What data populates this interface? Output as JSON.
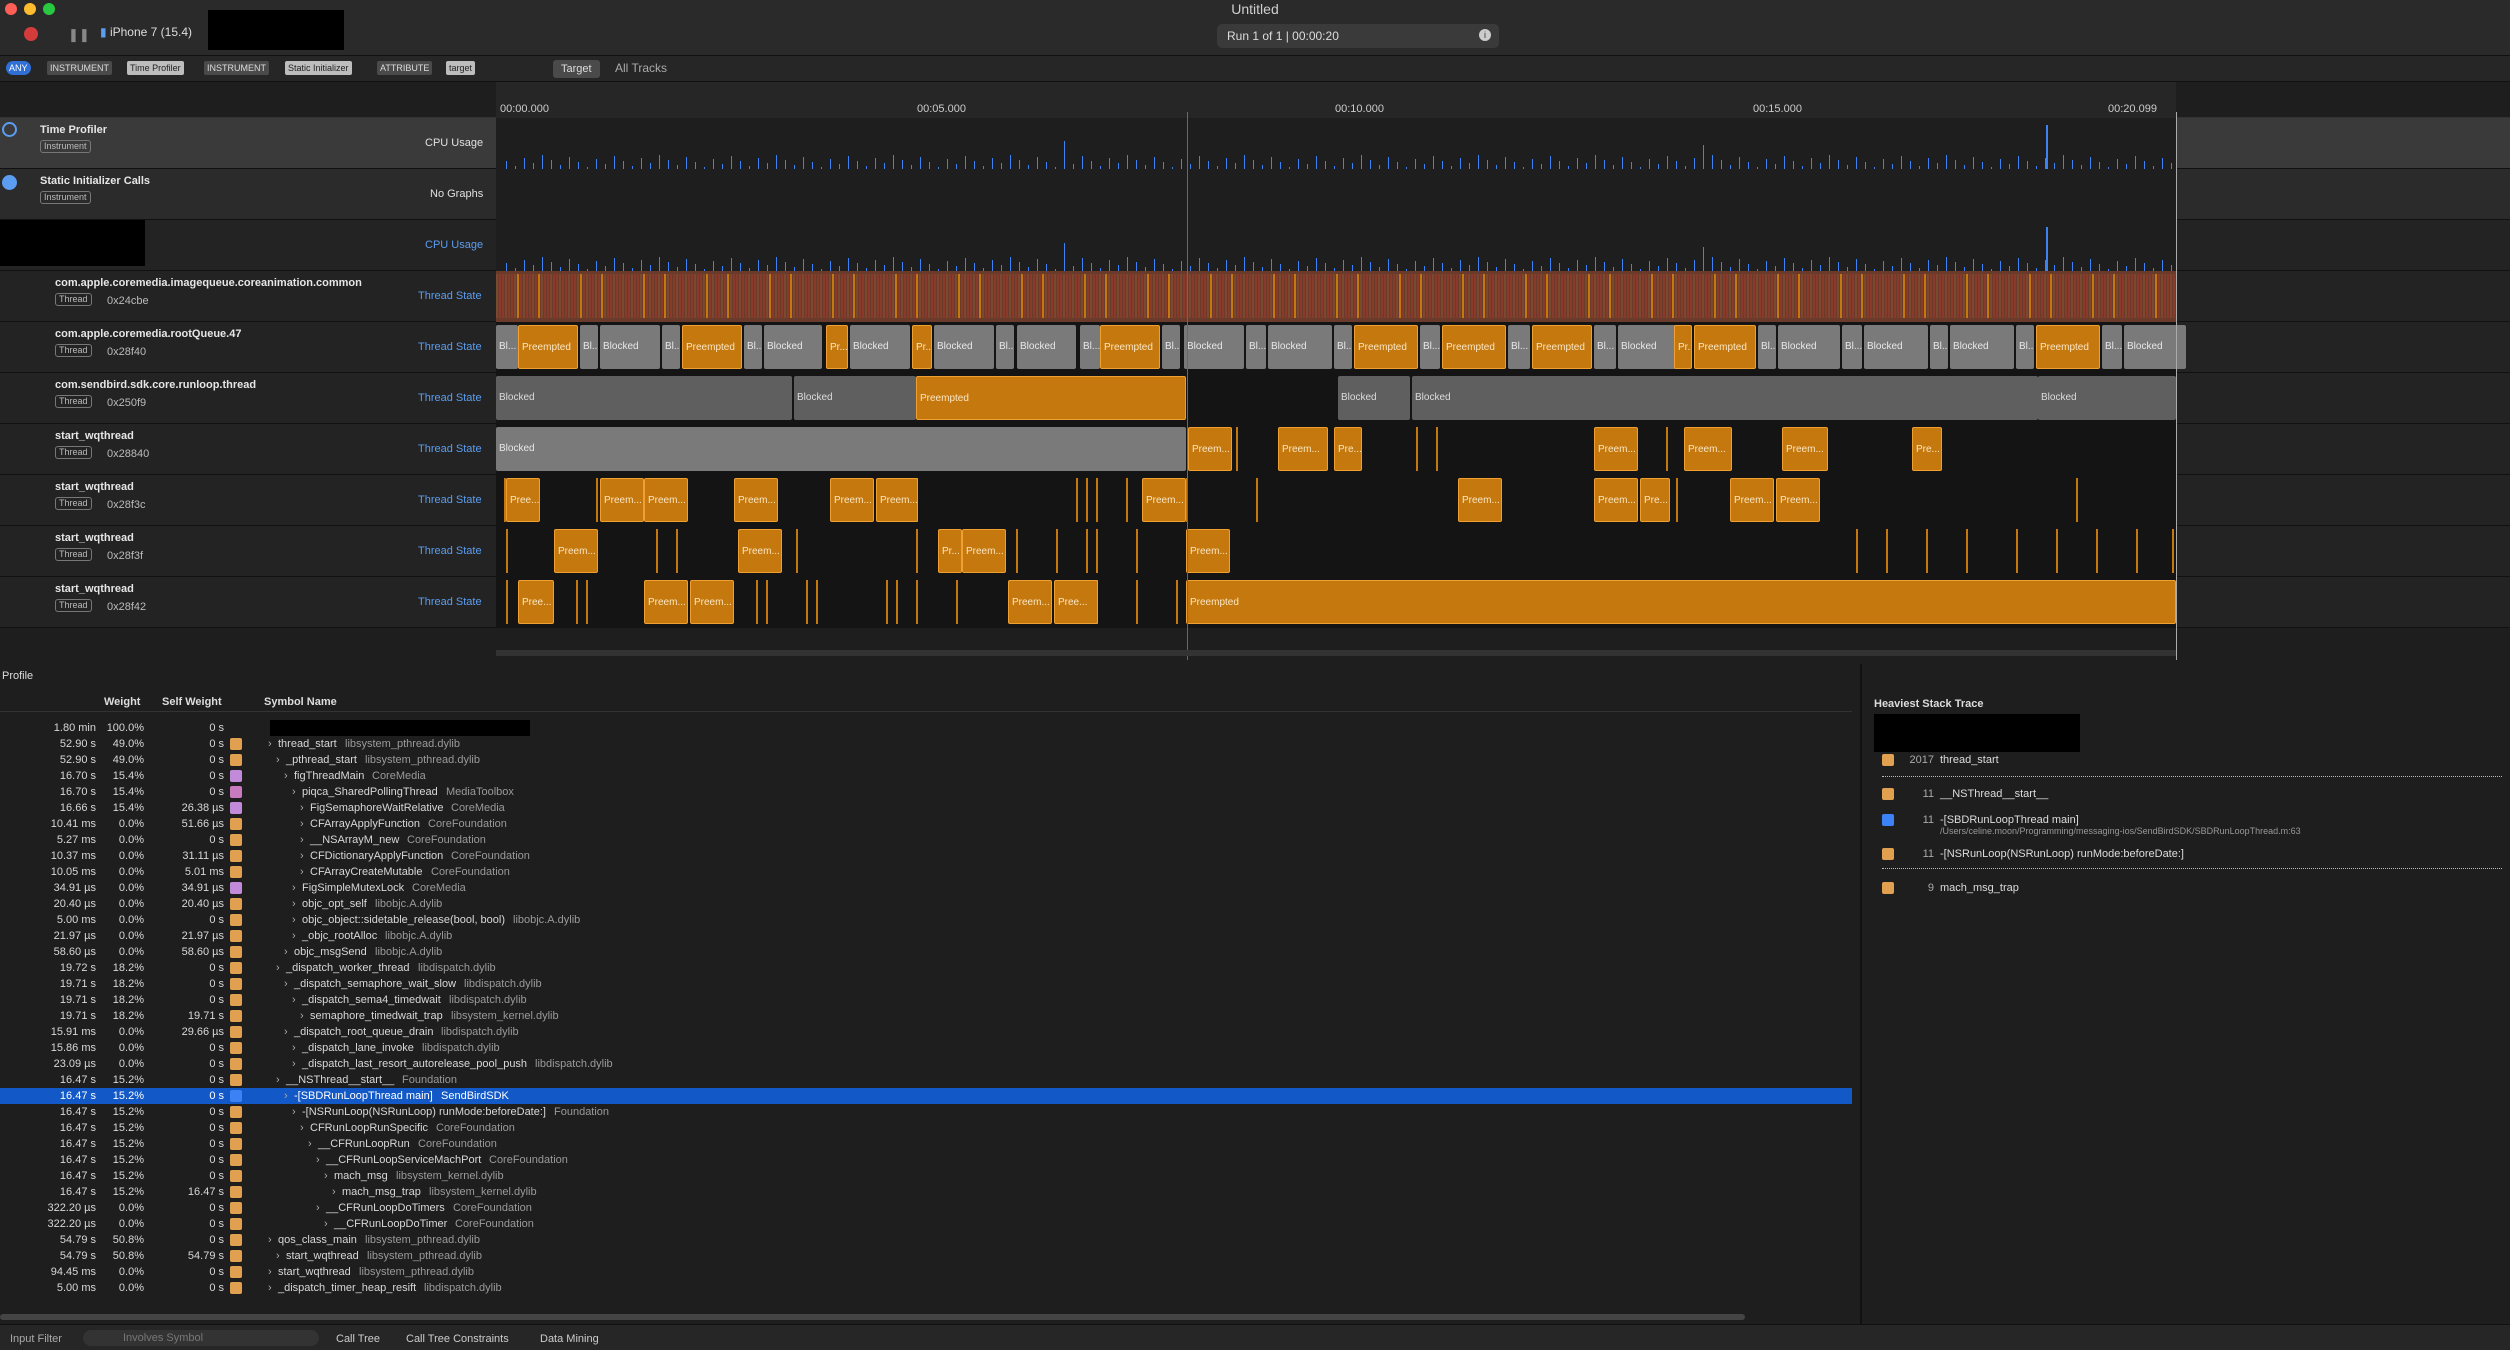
{
  "window": {
    "title": "Untitled",
    "device": "iPhone 7 (15.4)",
    "run": "Run 1 of 1  |  00:00:20",
    "info_icon": "info-icon"
  },
  "filter": {
    "any": "ANY",
    "chips": [
      "INSTRUMENT",
      "Time Profiler",
      "INSTRUMENT",
      "Static Initializer",
      "ATTRIBUTE",
      "target"
    ],
    "target_btn": "Target",
    "all_tracks": "All Tracks"
  },
  "timeline": {
    "ticks": [
      "00:00.000",
      "00:05.000",
      "00:10.000",
      "00:15.000",
      "00:20.099"
    ]
  },
  "instruments": [
    {
      "name": "Time Profiler",
      "badge": "Instrument",
      "graph": "CPU Usage"
    },
    {
      "name": "Static Initializer Calls",
      "badge": "Instrument",
      "graph": "No Graphs"
    }
  ],
  "cpu_usage_label": "CPU Usage",
  "threads": [
    {
      "name": "com.apple.coremedia.imagequeue.coreanimation.common",
      "addr": "0x24cbe",
      "state": "Thread State",
      "badge": "Thread"
    },
    {
      "name": "com.apple.coremedia.rootQueue.47",
      "addr": "0x28f40",
      "state": "Thread State",
      "badge": "Thread"
    },
    {
      "name": "com.sendbird.sdk.core.runloop.thread",
      "addr": "0x250f9",
      "state": "Thread State",
      "badge": "Thread"
    },
    {
      "name": "start_wqthread",
      "addr": "0x28840",
      "state": "Thread State",
      "badge": "Thread"
    },
    {
      "name": "start_wqthread",
      "addr": "0x28f3c",
      "state": "Thread State",
      "badge": "Thread"
    },
    {
      "name": "start_wqthread",
      "addr": "0x28f3f",
      "state": "Thread State",
      "badge": "Thread"
    },
    {
      "name": "start_wqthread",
      "addr": "0x28f42",
      "state": "Thread State",
      "badge": "Thread"
    }
  ],
  "segments": {
    "row1": [
      [
        "Bl...",
        "b"
      ],
      [
        "Preempted",
        "p"
      ],
      [
        "Bl...",
        "b"
      ],
      [
        "Blocked",
        "b"
      ],
      [
        "Bl...",
        "b"
      ],
      [
        "Preempted",
        "p"
      ],
      [
        "Bl...",
        "b"
      ],
      [
        "Blocked",
        "b"
      ],
      [
        "Pr...",
        "p"
      ],
      [
        "Blocked",
        "b"
      ],
      [
        "Pr...",
        "p"
      ],
      [
        "Blocked",
        "b"
      ],
      [
        "Bl...",
        "b"
      ],
      [
        "Blocked",
        "b"
      ],
      [
        "Bl...",
        "b"
      ],
      [
        "Preempted",
        "p"
      ],
      [
        "Bl...",
        "b"
      ],
      [
        "Blocked",
        "b"
      ],
      [
        "Bl...",
        "b"
      ],
      [
        "Blocked",
        "b"
      ],
      [
        "Bl...",
        "b"
      ],
      [
        "Preempted",
        "p"
      ],
      [
        "Bl...",
        "b"
      ],
      [
        "Preempted",
        "p"
      ],
      [
        "Bl...",
        "b"
      ],
      [
        "Preempted",
        "p"
      ],
      [
        "Bl...",
        "b"
      ],
      [
        "Blocked",
        "b"
      ],
      [
        "Pr...",
        "p"
      ],
      [
        "Preempted",
        "p"
      ],
      [
        "Bl...",
        "b"
      ],
      [
        "Blocked",
        "b"
      ],
      [
        "Bl...",
        "b"
      ],
      [
        "Blocked",
        "b"
      ],
      [
        "Bl...",
        "b"
      ],
      [
        "Blocked",
        "b"
      ],
      [
        "Bl...",
        "b"
      ],
      [
        "Preempted",
        "p"
      ],
      [
        "Bl...",
        "b"
      ],
      [
        "Blocked",
        "b"
      ]
    ],
    "row2": [
      [
        "Blocked",
        "b"
      ],
      [
        "Blocked",
        "b"
      ],
      [
        "Preempted",
        "p"
      ],
      [
        "Blocked",
        "b"
      ],
      [
        "Blocked",
        "b"
      ],
      [
        "Blocked",
        "b"
      ]
    ],
    "row3": [
      [
        "Blocked",
        "b"
      ],
      [
        "Preem...",
        "p"
      ],
      [
        "Preem...",
        "p"
      ],
      [
        "Pre...",
        "p"
      ],
      [
        "Preem...",
        "p"
      ],
      [
        "Preem...",
        "p"
      ],
      [
        "Preem...",
        "p"
      ],
      [
        "Pre...",
        "p"
      ]
    ],
    "row4": [
      [
        "Pree...",
        "p"
      ],
      [
        "Preem...",
        "p"
      ],
      [
        "Preem...",
        "p"
      ],
      [
        "Preem...",
        "p"
      ],
      [
        "Preem...",
        "p"
      ],
      [
        "Preem...",
        "p"
      ],
      [
        "Preem...",
        "p"
      ],
      [
        "Preem...",
        "p"
      ],
      [
        "Preem...",
        "p"
      ],
      [
        "Pre...",
        "p"
      ],
      [
        "Preem...",
        "p"
      ],
      [
        "Preem...",
        "p"
      ]
    ],
    "row5": [
      [
        "Preem...",
        "p"
      ],
      [
        "Preem...",
        "p"
      ],
      [
        "Pr...",
        "p"
      ],
      [
        "Preem...",
        "p"
      ],
      [
        "Preem...",
        "p"
      ]
    ],
    "row6": [
      [
        "Pree...",
        "p"
      ],
      [
        "Preem...",
        "p"
      ],
      [
        "Preem...",
        "p"
      ],
      [
        "Preem...",
        "p"
      ],
      [
        "Pree...",
        "p"
      ],
      [
        "Preempted",
        "p"
      ]
    ]
  },
  "profile": {
    "title": "Profile",
    "headers": {
      "weight": "Weight",
      "self": "Self Weight",
      "symbol": "Symbol Name"
    },
    "rows": [
      [
        "1.80 min",
        "100.0%",
        "0 s",
        "",
        ""
      ],
      [
        "52.90 s",
        "49.0%",
        "0 s",
        "thread_start",
        "libsystem_pthread.dylib"
      ],
      [
        "52.90 s",
        "49.0%",
        "0 s",
        "_pthread_start",
        "libsystem_pthread.dylib"
      ],
      [
        "16.70 s",
        "15.4%",
        "0 s",
        "figThreadMain",
        "CoreMedia"
      ],
      [
        "16.70 s",
        "15.4%",
        "0 s",
        "piqca_SharedPollingThread",
        "MediaToolbox"
      ],
      [
        "16.66 s",
        "15.4%",
        "26.38 µs",
        "FigSemaphoreWaitRelative",
        "CoreMedia"
      ],
      [
        "10.41 ms",
        "0.0%",
        "51.66 µs",
        "CFArrayApplyFunction",
        "CoreFoundation"
      ],
      [
        "5.27 ms",
        "0.0%",
        "0 s",
        "__NSArrayM_new",
        "CoreFoundation"
      ],
      [
        "10.37 ms",
        "0.0%",
        "31.11 µs",
        "CFDictionaryApplyFunction",
        "CoreFoundation"
      ],
      [
        "10.05 ms",
        "0.0%",
        "5.01 ms",
        "CFArrayCreateMutable",
        "CoreFoundation"
      ],
      [
        "34.91 µs",
        "0.0%",
        "34.91 µs",
        "FigSimpleMutexLock",
        "CoreMedia"
      ],
      [
        "20.40 µs",
        "0.0%",
        "20.40 µs",
        "objc_opt_self",
        "libobjc.A.dylib"
      ],
      [
        "5.00 ms",
        "0.0%",
        "0 s",
        "objc_object::sidetable_release(bool, bool)",
        "libobjc.A.dylib"
      ],
      [
        "21.97 µs",
        "0.0%",
        "21.97 µs",
        "_objc_rootAlloc",
        "libobjc.A.dylib"
      ],
      [
        "58.60 µs",
        "0.0%",
        "58.60 µs",
        "objc_msgSend",
        "libobjc.A.dylib"
      ],
      [
        "19.72 s",
        "18.2%",
        "0 s",
        "_dispatch_worker_thread",
        "libdispatch.dylib"
      ],
      [
        "19.71 s",
        "18.2%",
        "0 s",
        "_dispatch_semaphore_wait_slow",
        "libdispatch.dylib"
      ],
      [
        "19.71 s",
        "18.2%",
        "0 s",
        "_dispatch_sema4_timedwait",
        "libdispatch.dylib"
      ],
      [
        "19.71 s",
        "18.2%",
        "19.71 s",
        "semaphore_timedwait_trap",
        "libsystem_kernel.dylib"
      ],
      [
        "15.91 ms",
        "0.0%",
        "29.66 µs",
        "_dispatch_root_queue_drain",
        "libdispatch.dylib"
      ],
      [
        "15.86 ms",
        "0.0%",
        "0 s",
        "_dispatch_lane_invoke",
        "libdispatch.dylib"
      ],
      [
        "23.09 µs",
        "0.0%",
        "0 s",
        "_dispatch_last_resort_autorelease_pool_push",
        "libdispatch.dylib"
      ],
      [
        "16.47 s",
        "15.2%",
        "0 s",
        "__NSThread__start__",
        "Foundation"
      ],
      [
        "16.47 s",
        "15.2%",
        "0 s",
        "-[SBDRunLoopThread main]",
        "SendBirdSDK"
      ],
      [
        "16.47 s",
        "15.2%",
        "0 s",
        "-[NSRunLoop(NSRunLoop) runMode:beforeDate:]",
        "Foundation"
      ],
      [
        "16.47 s",
        "15.2%",
        "0 s",
        "CFRunLoopRunSpecific",
        "CoreFoundation"
      ],
      [
        "16.47 s",
        "15.2%",
        "0 s",
        "__CFRunLoopRun",
        "CoreFoundation"
      ],
      [
        "16.47 s",
        "15.2%",
        "0 s",
        "__CFRunLoopServiceMachPort",
        "CoreFoundation"
      ],
      [
        "16.47 s",
        "15.2%",
        "0 s",
        "mach_msg",
        "libsystem_kernel.dylib"
      ],
      [
        "16.47 s",
        "15.2%",
        "16.47 s",
        "mach_msg_trap",
        "libsystem_kernel.dylib"
      ],
      [
        "322.20 µs",
        "0.0%",
        "0 s",
        "__CFRunLoopDoTimers",
        "CoreFoundation"
      ],
      [
        "322.20 µs",
        "0.0%",
        "0 s",
        "__CFRunLoopDoTimer",
        "CoreFoundation"
      ],
      [
        "54.79 s",
        "50.8%",
        "0 s",
        "qos_class_main",
        "libsystem_pthread.dylib"
      ],
      [
        "54.79 s",
        "50.8%",
        "54.79 s",
        "start_wqthread",
        "libsystem_pthread.dylib"
      ],
      [
        "94.45 ms",
        "0.0%",
        "0 s",
        "start_wqthread",
        "libsystem_pthread.dylib"
      ],
      [
        "5.00 ms",
        "0.0%",
        "0 s",
        "_dispatch_timer_heap_resift",
        "libdispatch.dylib"
      ]
    ]
  },
  "heaviest": {
    "title": "Heaviest Stack Trace",
    "items": [
      [
        "2017",
        "thread_start",
        ""
      ],
      [
        "11",
        "__NSThread__start__",
        ""
      ],
      [
        "11",
        "-[SBDRunLoopThread main]",
        "/Users/celine.moon/Programming/messaging-ios/SendBirdSDK/SBDRunLoopThread.m:63"
      ],
      [
        "11",
        "-[NSRunLoop(NSRunLoop) runMode:beforeDate:]",
        ""
      ],
      [
        "9",
        "mach_msg_trap",
        ""
      ]
    ]
  },
  "bottom": {
    "input_filter": "Input Filter",
    "involves": "Involves Symbol",
    "call_tree": "Call Tree",
    "constraints": "Call Tree Constraints",
    "data_mining": "Data Mining"
  }
}
